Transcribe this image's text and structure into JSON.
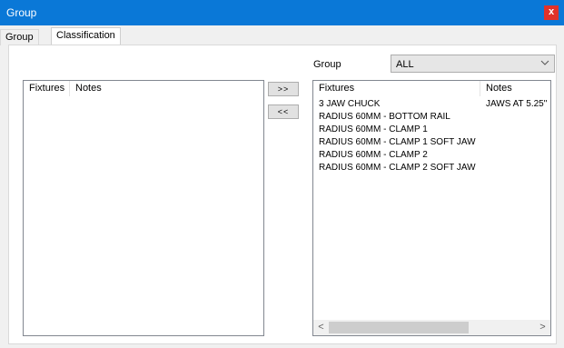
{
  "window": {
    "title": "Group",
    "close_glyph": "x"
  },
  "tabs": [
    {
      "label": "Group",
      "active": false
    },
    {
      "label": "Classification",
      "active": true
    }
  ],
  "filter": {
    "label": "Group",
    "selected": "ALL"
  },
  "left_list": {
    "columns": [
      "Fixtures",
      "Notes"
    ],
    "rows": []
  },
  "transfer": {
    "add_label": ">>",
    "remove_label": "<<"
  },
  "right_list": {
    "columns": [
      "Fixtures",
      "Notes"
    ],
    "rows": [
      {
        "fixture": "3 JAW CHUCK",
        "notes": "JAWS AT 5.25\""
      },
      {
        "fixture": "RADIUS 60MM - BOTTOM RAIL",
        "notes": ""
      },
      {
        "fixture": "RADIUS 60MM - CLAMP 1",
        "notes": ""
      },
      {
        "fixture": "RADIUS 60MM - CLAMP 1 SOFT JAW",
        "notes": ""
      },
      {
        "fixture": "RADIUS 60MM - CLAMP 2",
        "notes": ""
      },
      {
        "fixture": "RADIUS 60MM - CLAMP 2 SOFT JAW",
        "notes": ""
      }
    ],
    "scroll": {
      "left_arrow": "<",
      "right_arrow": ">",
      "thumb_fraction": 0.68
    }
  },
  "colors": {
    "titlebar": "#0a78d7",
    "close": "#e0322a",
    "window_bg": "#f0f0f0"
  },
  "icons": {
    "dropdown": "chevron-down-icon"
  }
}
